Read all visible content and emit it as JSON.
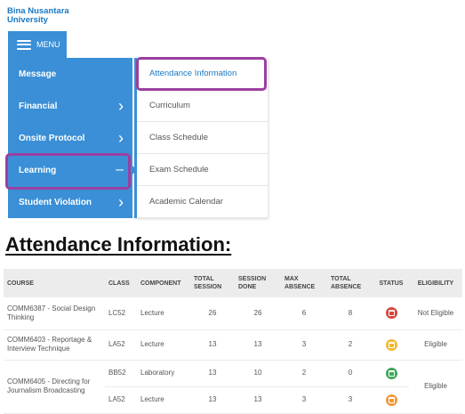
{
  "brand": {
    "line1": "Bina Nusantara",
    "line2": "University"
  },
  "menu_button": {
    "label": "MENU"
  },
  "left_menu": [
    {
      "label": "Message",
      "indicator": ""
    },
    {
      "label": "Financial",
      "indicator": "chevron"
    },
    {
      "label": "Onsite Protocol",
      "indicator": "chevron"
    },
    {
      "label": "Learning",
      "indicator": "minus"
    },
    {
      "label": "Student Violation",
      "indicator": "chevron"
    }
  ],
  "sub_menu": [
    {
      "label": "Attendance Information"
    },
    {
      "label": "Curriculum"
    },
    {
      "label": "Class Schedule"
    },
    {
      "label": "Exam Schedule"
    },
    {
      "label": "Academic Calendar"
    }
  ],
  "section_title": "Attendance Information:",
  "table": {
    "headers": {
      "course": "COURSE",
      "class": "CLASS",
      "component": "COMPONENT",
      "total_session": "TOTAL SESSION",
      "session_done": "SESSION DONE",
      "max_absence": "MAX ABSENCE",
      "total_absence": "TOTAL ABSENCE",
      "status": "STATUS",
      "eligibility": "ELIGIBILITY"
    },
    "rows": [
      {
        "course": "COMM6387 - Social Design Thinking",
        "class": "LC52",
        "component": "Lecture",
        "total_session": "26",
        "session_done": "26",
        "max_absence": "6",
        "total_absence": "8",
        "status_color": "#d9443c",
        "eligibility": "Not Eligible"
      },
      {
        "course": "COMM6403 - Reportage & Interview Technique",
        "class": "LA52",
        "component": "Lecture",
        "total_session": "13",
        "session_done": "13",
        "max_absence": "3",
        "total_absence": "2",
        "status_color": "#f2b830",
        "eligibility": "Eligible"
      },
      {
        "course": "COMM6405 - Directing for Journalism Broadcasting",
        "class": "BB52",
        "component": "Laboratory",
        "total_session": "13",
        "session_done": "10",
        "max_absence": "2",
        "total_absence": "0",
        "status_color": "#3ea85a",
        "eligibility": "Eligible"
      },
      {
        "course": "",
        "class": "LA52",
        "component": "Lecture",
        "total_session": "13",
        "session_done": "13",
        "max_absence": "3",
        "total_absence": "3",
        "status_color": "#ee9a3a",
        "eligibility": ""
      }
    ]
  },
  "colors": {
    "menu_blue": "#3a8fd6",
    "brand_blue": "#1a78c2",
    "highlight": "#9a3fa0"
  }
}
